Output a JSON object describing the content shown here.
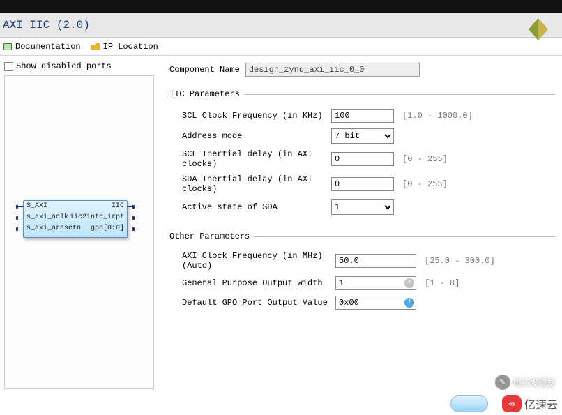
{
  "top_strip": "",
  "title": "AXI IIC (2.0)",
  "toolbar": {
    "documentation": "Documentation",
    "ip_location": "IP Location"
  },
  "show_disabled_label": "Show disabled ports",
  "component_name_label": "Component Name",
  "component_name_value": "design_zynq_axi_iic_0_0",
  "iic_legend": "IIC Parameters",
  "iic": {
    "scl_freq_label": "SCL Clock Frequency (in KHz)",
    "scl_freq_value": "100",
    "scl_freq_hint": "[1.0 - 1000.0]",
    "addr_mode_label": "Address mode",
    "addr_mode_value": "7 bit",
    "scl_inertial_label": "SCL Inertial delay (in AXI clocks)",
    "scl_inertial_value": "0",
    "scl_inertial_hint": "[0 - 255]",
    "sda_inertial_label": "SDA Inertial delay (in AXI clocks)",
    "sda_inertial_value": "0",
    "sda_inertial_hint": "[0 - 255]",
    "active_sda_label": "Active state of SDA",
    "active_sda_value": "1"
  },
  "other_legend": "Other Parameters",
  "other": {
    "axi_clk_label": " AXI Clock Frequency (in MHz) (Auto)",
    "axi_clk_value": "50.0",
    "axi_clk_hint": "[25.0 - 300.0]",
    "gpo_width_label": "General Purpose Output width",
    "gpo_width_value": "1",
    "gpo_width_hint": "[1 - 8]",
    "gpo_default_label": "Default GPO Port Output Value",
    "gpo_default_value": "0x00"
  },
  "block": {
    "s_axi": "S_AXI",
    "iic": "IIC",
    "s_axi_aclk": "s_axi_aclk",
    "iic2intc_irpt": "iic2intc_irpt",
    "s_axi_aresetn": "s_axi_aresetn",
    "gpo": "gpo[0:0]"
  },
  "watermark1": "电子发烧友",
  "watermark2": "亿速云"
}
